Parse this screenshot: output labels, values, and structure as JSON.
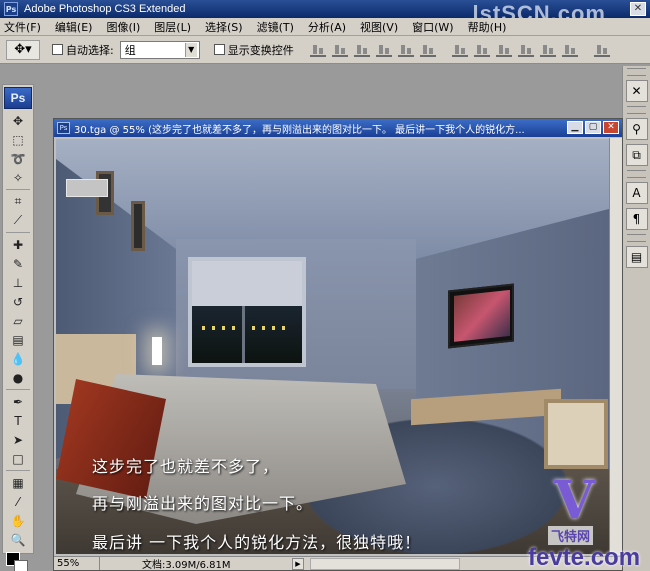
{
  "app": {
    "title": "Adobe Photoshop CS3 Extended",
    "icon": "ps-icon"
  },
  "watermark_top": "lstSCN.com",
  "menu": [
    "文件(F)",
    "编辑(E)",
    "图像(I)",
    "图层(L)",
    "选择(S)",
    "滤镜(T)",
    "分析(A)",
    "视图(V)",
    "窗口(W)",
    "帮助(H)"
  ],
  "options": {
    "auto_select_label": "自动选择:",
    "auto_select_value": "组",
    "show_transform_label": "显示变换控件"
  },
  "toolbox": {
    "logo": "Ps",
    "tools": [
      "move",
      "marquee",
      "lasso",
      "magic-wand",
      "crop",
      "slice",
      "healing",
      "brush",
      "stamp",
      "history-brush",
      "eraser",
      "gradient",
      "blur",
      "dodge",
      "pen",
      "type",
      "path-select",
      "shape",
      "notes",
      "eyedropper",
      "hand",
      "zoom"
    ]
  },
  "document": {
    "title": "30.tga @ 55% (这步完了也就差不多了，再与刚溢出来的图对比一下。  最后讲一下我个人的锐化方...",
    "captions": [
      "这步完了也就差不多了，",
      "再与刚溢出来的图对比一下。",
      "最后讲 一下我个人的锐化方法，很独特哦！"
    ],
    "zoom": "55%",
    "doc_size": "文档:3.09M/6.81M"
  },
  "watermark_bottom": {
    "logo": "V",
    "name": "飞特网",
    "url": "fevte.com"
  },
  "colors": {
    "titlebar": "#0b2a6b",
    "chrome": "#d4d0c8"
  }
}
